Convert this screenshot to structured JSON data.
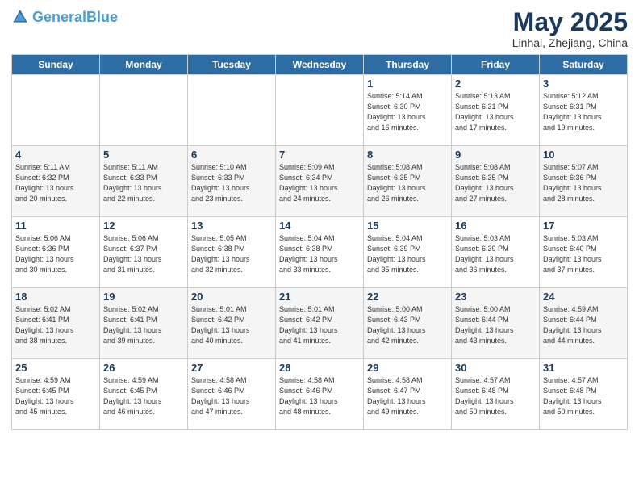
{
  "header": {
    "logo_general": "General",
    "logo_blue": "Blue",
    "month_title": "May 2025",
    "location": "Linhai, Zhejiang, China"
  },
  "days_of_week": [
    "Sunday",
    "Monday",
    "Tuesday",
    "Wednesday",
    "Thursday",
    "Friday",
    "Saturday"
  ],
  "weeks": [
    [
      {
        "day": "",
        "info": ""
      },
      {
        "day": "",
        "info": ""
      },
      {
        "day": "",
        "info": ""
      },
      {
        "day": "",
        "info": ""
      },
      {
        "day": "1",
        "info": "Sunrise: 5:14 AM\nSunset: 6:30 PM\nDaylight: 13 hours\nand 16 minutes."
      },
      {
        "day": "2",
        "info": "Sunrise: 5:13 AM\nSunset: 6:31 PM\nDaylight: 13 hours\nand 17 minutes."
      },
      {
        "day": "3",
        "info": "Sunrise: 5:12 AM\nSunset: 6:31 PM\nDaylight: 13 hours\nand 19 minutes."
      }
    ],
    [
      {
        "day": "4",
        "info": "Sunrise: 5:11 AM\nSunset: 6:32 PM\nDaylight: 13 hours\nand 20 minutes."
      },
      {
        "day": "5",
        "info": "Sunrise: 5:11 AM\nSunset: 6:33 PM\nDaylight: 13 hours\nand 22 minutes."
      },
      {
        "day": "6",
        "info": "Sunrise: 5:10 AM\nSunset: 6:33 PM\nDaylight: 13 hours\nand 23 minutes."
      },
      {
        "day": "7",
        "info": "Sunrise: 5:09 AM\nSunset: 6:34 PM\nDaylight: 13 hours\nand 24 minutes."
      },
      {
        "day": "8",
        "info": "Sunrise: 5:08 AM\nSunset: 6:35 PM\nDaylight: 13 hours\nand 26 minutes."
      },
      {
        "day": "9",
        "info": "Sunrise: 5:08 AM\nSunset: 6:35 PM\nDaylight: 13 hours\nand 27 minutes."
      },
      {
        "day": "10",
        "info": "Sunrise: 5:07 AM\nSunset: 6:36 PM\nDaylight: 13 hours\nand 28 minutes."
      }
    ],
    [
      {
        "day": "11",
        "info": "Sunrise: 5:06 AM\nSunset: 6:36 PM\nDaylight: 13 hours\nand 30 minutes."
      },
      {
        "day": "12",
        "info": "Sunrise: 5:06 AM\nSunset: 6:37 PM\nDaylight: 13 hours\nand 31 minutes."
      },
      {
        "day": "13",
        "info": "Sunrise: 5:05 AM\nSunset: 6:38 PM\nDaylight: 13 hours\nand 32 minutes."
      },
      {
        "day": "14",
        "info": "Sunrise: 5:04 AM\nSunset: 6:38 PM\nDaylight: 13 hours\nand 33 minutes."
      },
      {
        "day": "15",
        "info": "Sunrise: 5:04 AM\nSunset: 6:39 PM\nDaylight: 13 hours\nand 35 minutes."
      },
      {
        "day": "16",
        "info": "Sunrise: 5:03 AM\nSunset: 6:39 PM\nDaylight: 13 hours\nand 36 minutes."
      },
      {
        "day": "17",
        "info": "Sunrise: 5:03 AM\nSunset: 6:40 PM\nDaylight: 13 hours\nand 37 minutes."
      }
    ],
    [
      {
        "day": "18",
        "info": "Sunrise: 5:02 AM\nSunset: 6:41 PM\nDaylight: 13 hours\nand 38 minutes."
      },
      {
        "day": "19",
        "info": "Sunrise: 5:02 AM\nSunset: 6:41 PM\nDaylight: 13 hours\nand 39 minutes."
      },
      {
        "day": "20",
        "info": "Sunrise: 5:01 AM\nSunset: 6:42 PM\nDaylight: 13 hours\nand 40 minutes."
      },
      {
        "day": "21",
        "info": "Sunrise: 5:01 AM\nSunset: 6:42 PM\nDaylight: 13 hours\nand 41 minutes."
      },
      {
        "day": "22",
        "info": "Sunrise: 5:00 AM\nSunset: 6:43 PM\nDaylight: 13 hours\nand 42 minutes."
      },
      {
        "day": "23",
        "info": "Sunrise: 5:00 AM\nSunset: 6:44 PM\nDaylight: 13 hours\nand 43 minutes."
      },
      {
        "day": "24",
        "info": "Sunrise: 4:59 AM\nSunset: 6:44 PM\nDaylight: 13 hours\nand 44 minutes."
      }
    ],
    [
      {
        "day": "25",
        "info": "Sunrise: 4:59 AM\nSunset: 6:45 PM\nDaylight: 13 hours\nand 45 minutes."
      },
      {
        "day": "26",
        "info": "Sunrise: 4:59 AM\nSunset: 6:45 PM\nDaylight: 13 hours\nand 46 minutes."
      },
      {
        "day": "27",
        "info": "Sunrise: 4:58 AM\nSunset: 6:46 PM\nDaylight: 13 hours\nand 47 minutes."
      },
      {
        "day": "28",
        "info": "Sunrise: 4:58 AM\nSunset: 6:46 PM\nDaylight: 13 hours\nand 48 minutes."
      },
      {
        "day": "29",
        "info": "Sunrise: 4:58 AM\nSunset: 6:47 PM\nDaylight: 13 hours\nand 49 minutes."
      },
      {
        "day": "30",
        "info": "Sunrise: 4:57 AM\nSunset: 6:48 PM\nDaylight: 13 hours\nand 50 minutes."
      },
      {
        "day": "31",
        "info": "Sunrise: 4:57 AM\nSunset: 6:48 PM\nDaylight: 13 hours\nand 50 minutes."
      }
    ]
  ]
}
